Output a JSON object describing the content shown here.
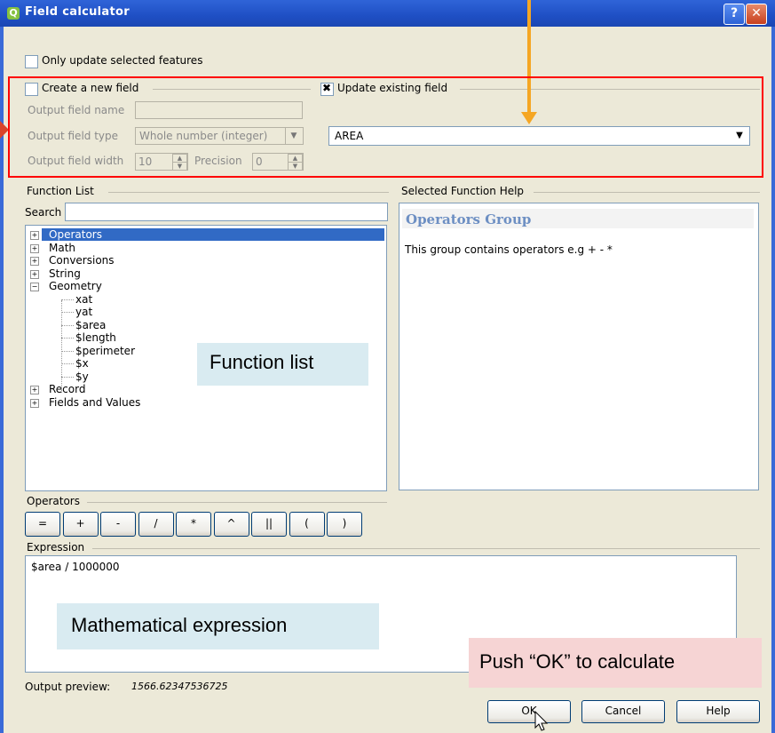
{
  "window": {
    "title": "Field calculator",
    "help_glyph": "?",
    "close_glyph": "✕"
  },
  "only_update": {
    "label": "Only update selected features",
    "checked": false
  },
  "new_field": {
    "label": "Create a new field",
    "checked": false,
    "name_label": "Output field name",
    "name_value": "",
    "type_label": "Output field type",
    "type_value": "Whole number (integer)",
    "width_label": "Output field width",
    "width_value": "10",
    "precision_label": "Precision",
    "precision_value": "0"
  },
  "update_field": {
    "label": "Update existing field",
    "checked": true,
    "selected": "AREA"
  },
  "function_list": {
    "title": "Function List",
    "search_label": "Search",
    "search_value": "",
    "items": [
      {
        "label": "Operators",
        "expander": "+",
        "selected": true
      },
      {
        "label": "Math",
        "expander": "+"
      },
      {
        "label": "Conversions",
        "expander": "+"
      },
      {
        "label": "String",
        "expander": "+"
      },
      {
        "label": "Geometry",
        "expander": "−"
      },
      {
        "label": "xat"
      },
      {
        "label": "yat"
      },
      {
        "label": "$area"
      },
      {
        "label": "$length"
      },
      {
        "label": "$perimeter"
      },
      {
        "label": "$x"
      },
      {
        "label": "$y"
      },
      {
        "label": "Record",
        "expander": "+"
      },
      {
        "label": "Fields and Values",
        "expander": "+"
      }
    ]
  },
  "help": {
    "title": "Selected Function Help",
    "heading": "Operators Group",
    "body": "This group contains operators e.g + - *"
  },
  "operators": {
    "title": "Operators",
    "buttons": [
      "=",
      "+",
      "-",
      "/",
      "*",
      "^",
      "||",
      "(",
      ")"
    ]
  },
  "expression": {
    "title": "Expression",
    "value": "$area  / 1000000"
  },
  "preview": {
    "label": "Output preview:",
    "value": "1566.62347536725"
  },
  "buttons": {
    "ok": "OK",
    "cancel": "Cancel",
    "help": "Help"
  },
  "annotations": {
    "function_list": "Function list",
    "expression": "Mathematical expression",
    "ok": "Push “OK” to calculate",
    "arrow_color": "#f5a623",
    "highlight_color": "#ff0000"
  }
}
